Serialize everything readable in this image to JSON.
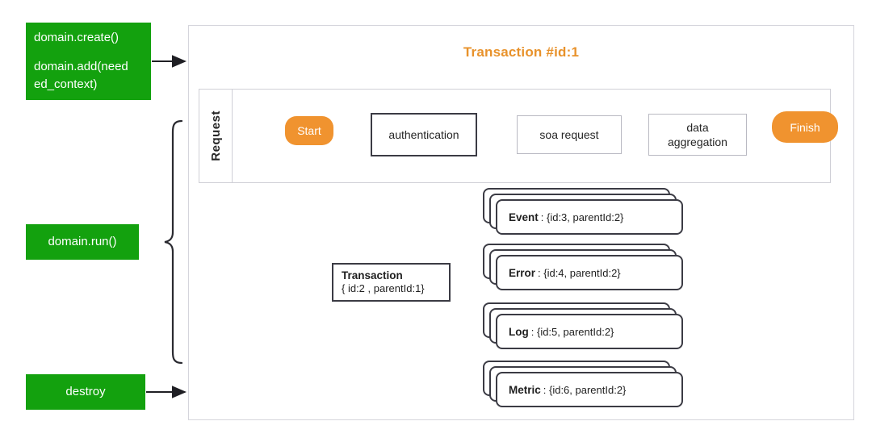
{
  "diagram": {
    "title": "Transaction #id:1",
    "accent_orange": "#F0932F",
    "accent_green": "#13a10e",
    "ink": "#3b3b44"
  },
  "lifecycle": {
    "create_line1": "domain.create()",
    "create_line2": "domain.add(need",
    "create_line3": "ed_context)",
    "run": "domain.run()",
    "destroy": "destroy"
  },
  "request": {
    "label": "Request",
    "steps": [
      {
        "name": "start-pill",
        "label": "Start"
      },
      {
        "name": "authentication",
        "label": "authentication"
      },
      {
        "name": "soa-request",
        "label": "soa request"
      },
      {
        "name": "data-aggregation",
        "line1": "data",
        "line2": "aggregation"
      },
      {
        "name": "finish-pill",
        "label": "Finish"
      }
    ]
  },
  "child_transaction": {
    "name": "Transaction",
    "props": "{ id:2 , parentId:1}"
  },
  "telemetry_cards": [
    {
      "label": "Event",
      "props": ": {id:3, parentId:2}"
    },
    {
      "label": "Error",
      "props": ": {id:4, parentId:2}"
    },
    {
      "label": "Log",
      "props": ": {id:5, parentId:2}"
    },
    {
      "label": "Metric",
      "props": ": {id:6, parentId:2}"
    }
  ]
}
